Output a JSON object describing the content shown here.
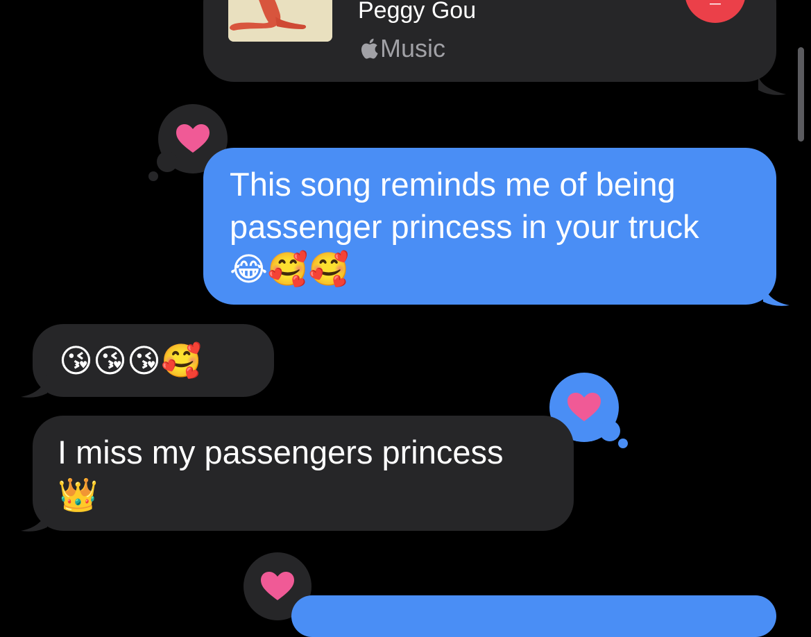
{
  "colors": {
    "background": "#000000",
    "sent_bubble": "#4a8ef5",
    "received_bubble": "#262628",
    "heart": "#f05a96",
    "music_play_button": "#eb4049",
    "secondary_text": "#a1a1a6"
  },
  "music_card": {
    "artist": "Peggy Gou",
    "provider_icon": "apple-logo-icon",
    "provider_label": "Music"
  },
  "messages": [
    {
      "direction": "sent",
      "text": "This song reminds me of being\npassenger princess in your truck\n😂🥰🥰",
      "reaction": "heart-icon"
    },
    {
      "direction": "received",
      "text": "😘😘😘🥰"
    },
    {
      "direction": "received",
      "text": "I miss my passengers princess\n👑",
      "reaction": "heart-icon"
    },
    {
      "direction": "sent",
      "text": "",
      "reaction": "heart-icon"
    }
  ]
}
